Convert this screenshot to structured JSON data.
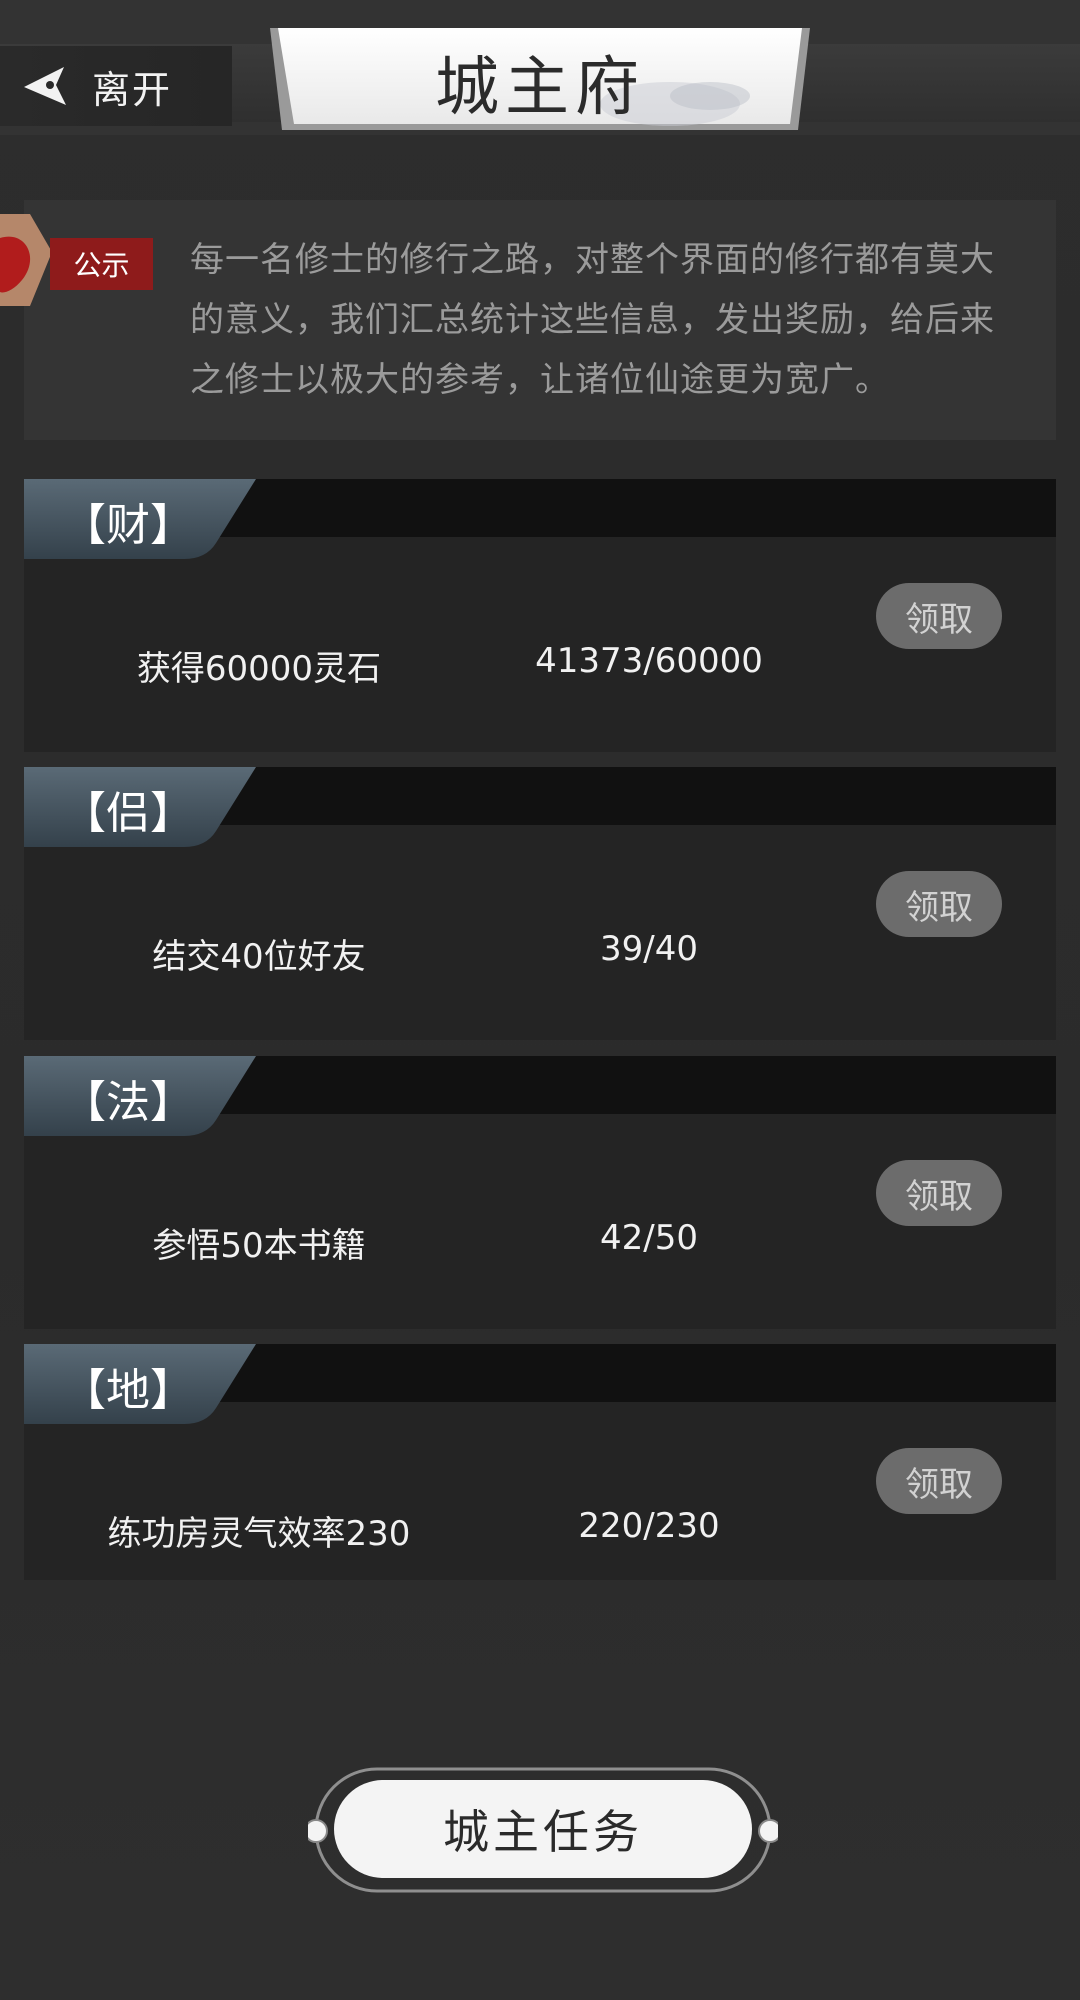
{
  "header": {
    "back_label": "离开",
    "title": "城主府"
  },
  "notice": {
    "tag": "公示",
    "lines": [
      "每一名修士的修行之路，对整个界面的修行都有莫大",
      "的意义，我们汇总统计这些信息，发出奖励，给后来",
      "之修士以极大的参考，让诸位仙途更为宽广。"
    ]
  },
  "tasks": [
    {
      "category": "【财】",
      "description": "获得60000灵石",
      "progress": "41373/60000",
      "button": "领取"
    },
    {
      "category": "【侣】",
      "description": "结交40位好友",
      "progress": "39/40",
      "button": "领取"
    },
    {
      "category": "【法】",
      "description": "参悟50本书籍",
      "progress": "42/50",
      "button": "领取"
    },
    {
      "category": "【地】",
      "description": "练功房灵气效率230",
      "progress": "220/230",
      "button": "领取"
    }
  ],
  "footer": {
    "mission_label": "城主任务"
  },
  "colors": {
    "background": "#2f2f2f",
    "card": "#242424",
    "card_bar": "#111111",
    "notice_tag": "#8e1b1b",
    "claim_button": "#6c6c6c"
  }
}
